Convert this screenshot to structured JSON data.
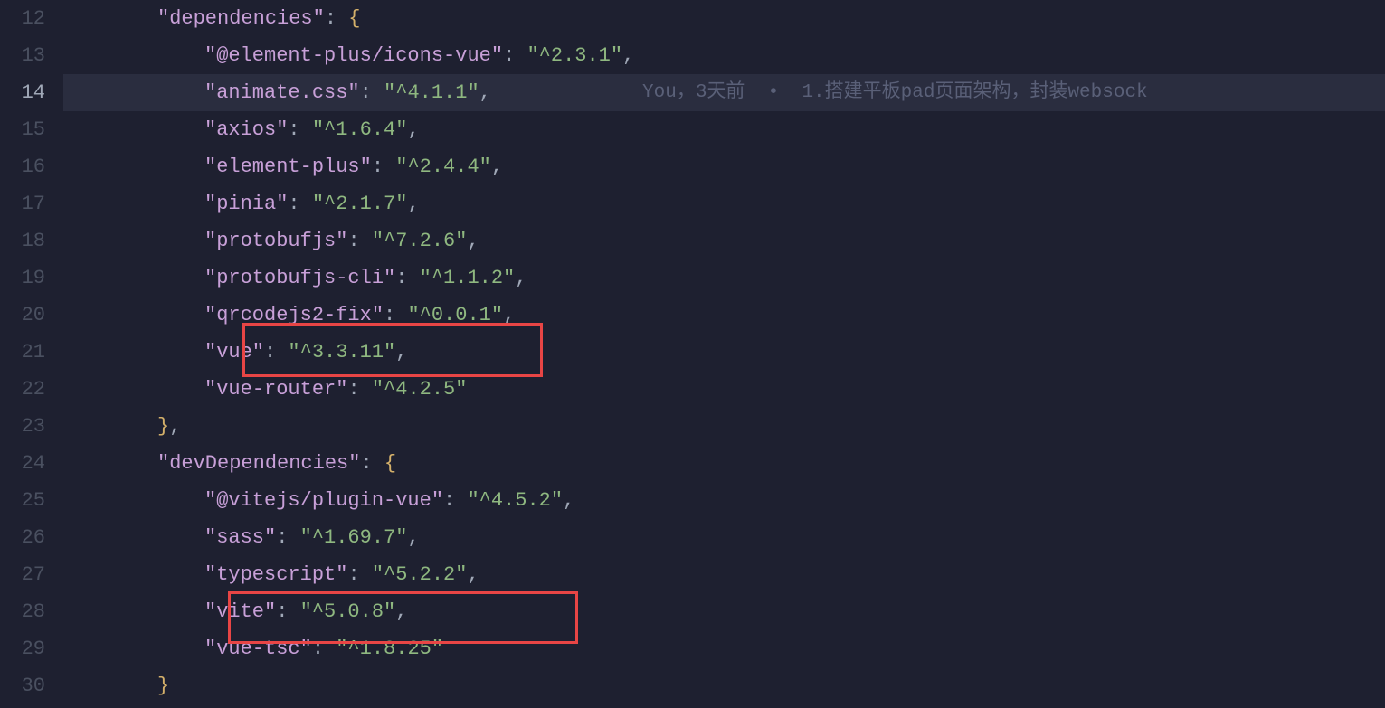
{
  "lines": [
    {
      "num": "12",
      "indent": 2,
      "type": "key-brace",
      "key": "dependencies",
      "active": false
    },
    {
      "num": "13",
      "indent": 3,
      "type": "kv",
      "key": "@element-plus/icons-vue",
      "value": "^2.3.1",
      "comma": true,
      "active": false
    },
    {
      "num": "14",
      "indent": 3,
      "type": "kv",
      "key": "animate.css",
      "value": "^4.1.1",
      "comma": true,
      "active": true,
      "gitlens": {
        "author": "You",
        "when": "3天前",
        "msg": "1.搭建平板pad页面架构，封装websock"
      }
    },
    {
      "num": "15",
      "indent": 3,
      "type": "kv",
      "key": "axios",
      "value": "^1.6.4",
      "comma": true,
      "active": false
    },
    {
      "num": "16",
      "indent": 3,
      "type": "kv",
      "key": "element-plus",
      "value": "^2.4.4",
      "comma": true,
      "active": false
    },
    {
      "num": "17",
      "indent": 3,
      "type": "kv",
      "key": "pinia",
      "value": "^2.1.7",
      "comma": true,
      "active": false
    },
    {
      "num": "18",
      "indent": 3,
      "type": "kv",
      "key": "protobufjs",
      "value": "^7.2.6",
      "comma": true,
      "active": false
    },
    {
      "num": "19",
      "indent": 3,
      "type": "kv",
      "key": "protobufjs-cli",
      "value": "^1.1.2",
      "comma": true,
      "active": false
    },
    {
      "num": "20",
      "indent": 3,
      "type": "kv",
      "key": "qrcodejs2-fix",
      "value": "^0.0.1",
      "comma": true,
      "active": false
    },
    {
      "num": "21",
      "indent": 3,
      "type": "kv",
      "key": "vue",
      "value": "^3.3.11",
      "comma": true,
      "active": false
    },
    {
      "num": "22",
      "indent": 3,
      "type": "kv",
      "key": "vue-router",
      "value": "^4.2.5",
      "comma": false,
      "active": false
    },
    {
      "num": "23",
      "indent": 2,
      "type": "close",
      "comma": true,
      "active": false
    },
    {
      "num": "24",
      "indent": 2,
      "type": "key-brace",
      "key": "devDependencies",
      "active": false
    },
    {
      "num": "25",
      "indent": 3,
      "type": "kv",
      "key": "@vitejs/plugin-vue",
      "value": "^4.5.2",
      "comma": true,
      "active": false
    },
    {
      "num": "26",
      "indent": 3,
      "type": "kv",
      "key": "sass",
      "value": "^1.69.7",
      "comma": true,
      "active": false
    },
    {
      "num": "27",
      "indent": 3,
      "type": "kv",
      "key": "typescript",
      "value": "^5.2.2",
      "comma": true,
      "active": false
    },
    {
      "num": "28",
      "indent": 3,
      "type": "kv",
      "key": "vite",
      "value": "^5.0.8",
      "comma": true,
      "active": false
    },
    {
      "num": "29",
      "indent": 3,
      "type": "kv",
      "key": "vue-tsc",
      "value": "^1.8.25",
      "comma": false,
      "active": false
    },
    {
      "num": "30",
      "indent": 2,
      "type": "close",
      "comma": false,
      "active": false
    }
  ]
}
